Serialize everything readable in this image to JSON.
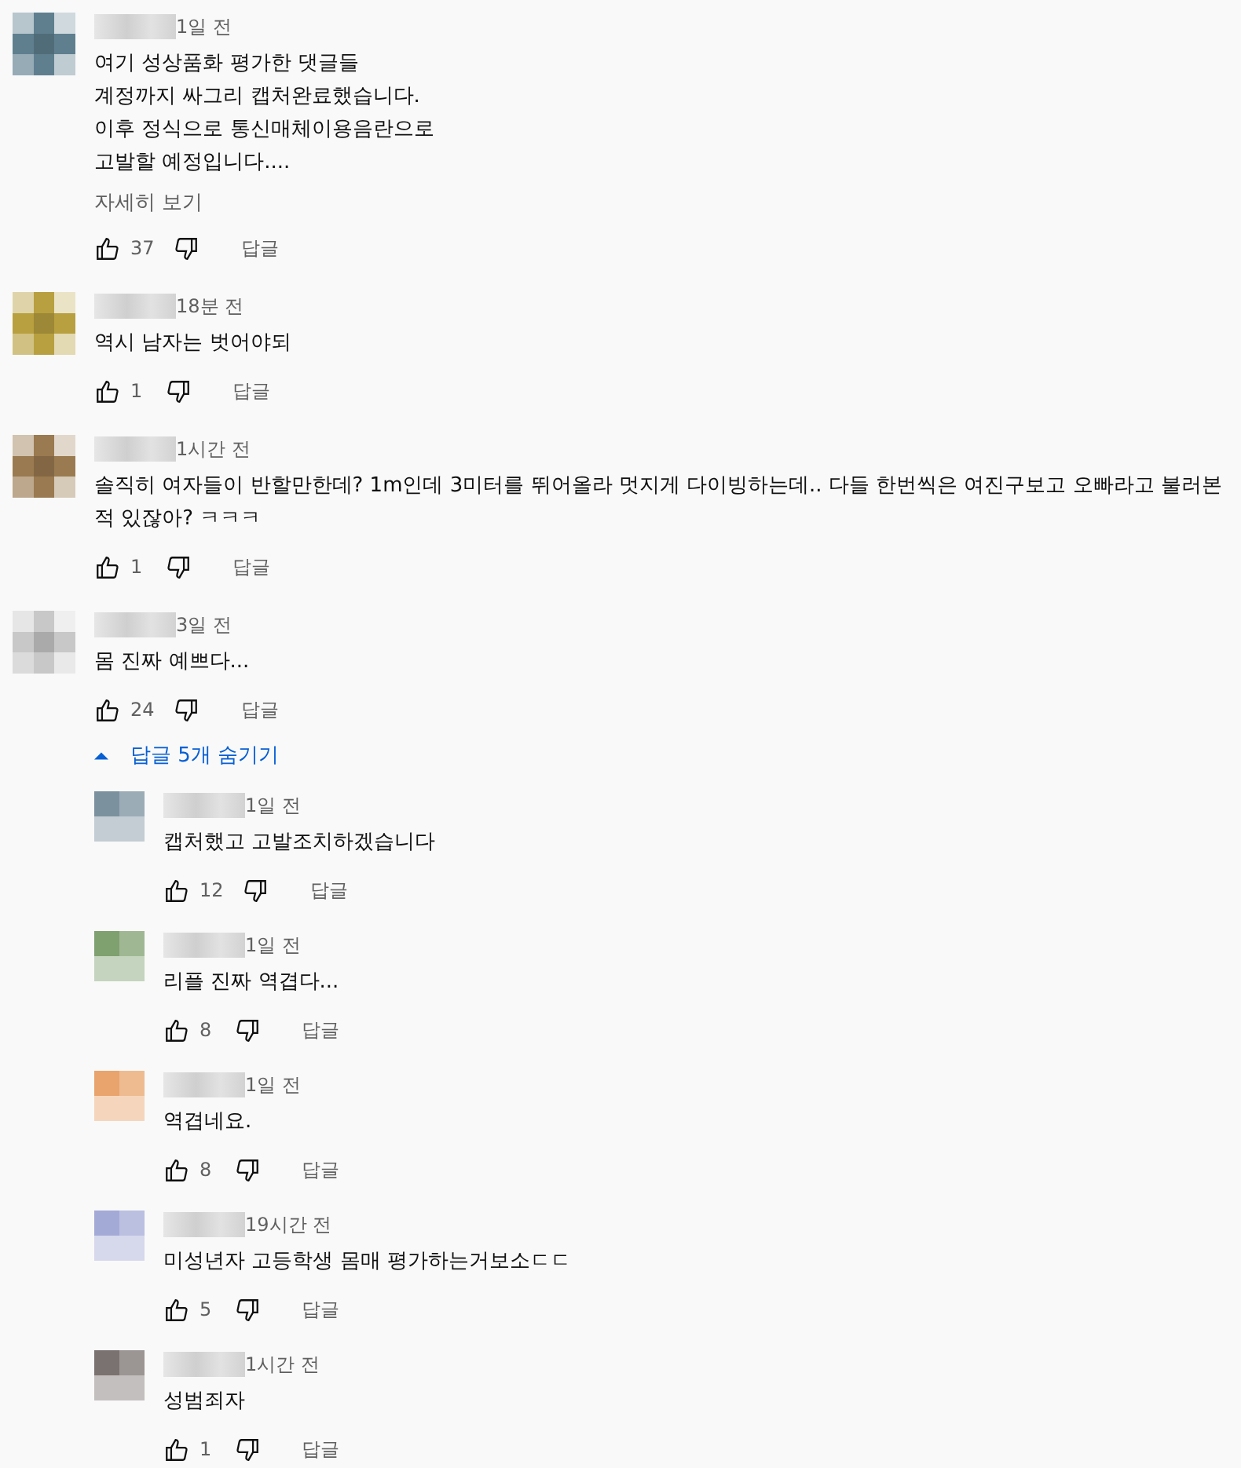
{
  "comments": [
    {
      "color": "#5f7f8f",
      "time": "1일 전",
      "lines": [
        "여기 성상품화 평가한 댓글들",
        "계정까지 싸그리 캡처완료했습니다.",
        "이후 정식으로 통신매체이용음란으로",
        "고발할 예정입니다...."
      ],
      "more": "자세히 보기",
      "likes": "37",
      "reply": "답글"
    },
    {
      "color": "#b8a040",
      "time": "18분 전",
      "lines": [
        "역시 남자는 벗어야되"
      ],
      "likes": "1",
      "reply": "답글"
    },
    {
      "color": "#9a7a50",
      "time": "1시간 전",
      "lines": [
        "솔직히 여자들이 반할만한데? 1m인데 3미터를 뛰어올라 멋지게 다이빙하는데.. 다들 한번씩은 여진구보고 오빠라고 불러본 적 있잖아? ㅋㅋㅋ"
      ],
      "likes": "1",
      "reply": "답글"
    },
    {
      "color": "#c8c8c8",
      "time": "3일 전",
      "lines": [
        "몸 진짜 예쁘다..."
      ],
      "likes": "24",
      "reply": "답글",
      "replies_toggle": {
        "label": "답글 5개 숨기기",
        "expanded": true
      },
      "replies": [
        {
          "color": "#7b919e",
          "time": "1일 전",
          "lines": [
            "캡처했고 고발조치하겠습니다"
          ],
          "likes": "12",
          "reply": "답글"
        },
        {
          "color": "#7fa06f",
          "time": "1일 전",
          "lines": [
            "리플 진짜 역겹다..."
          ],
          "likes": "8",
          "reply": "답글"
        },
        {
          "color": "#e8a46c",
          "time": "1일 전",
          "lines": [
            "역겹네요."
          ],
          "likes": "8",
          "reply": "답글"
        },
        {
          "color": "#a4aad6",
          "time": "19시간 전",
          "lines": [
            "미성년자 고등학생 몸매 평가하는거보소ㄷㄷ"
          ],
          "likes": "5",
          "reply": "답글"
        },
        {
          "color": "#7a7270",
          "time": "1시간 전",
          "lines": [
            "성범죄자"
          ],
          "likes": "1",
          "reply": "답글"
        }
      ]
    }
  ]
}
